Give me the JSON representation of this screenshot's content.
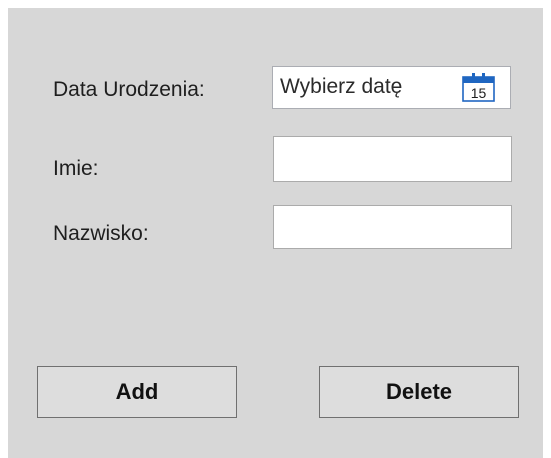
{
  "form": {
    "birthdate_label": "Data Urodzenia:",
    "birthdate_placeholder": "Wybierz datę",
    "calendar_day": "15",
    "firstname_label": "Imie:",
    "firstname_value": "",
    "lastname_label": "Nazwisko:",
    "lastname_value": ""
  },
  "buttons": {
    "add_label": "Add",
    "delete_label": "Delete"
  },
  "colors": {
    "window_background": "#d7d7d7",
    "calendar_accent": "#1f66c1"
  },
  "icons": {
    "calendar": "calendar-icon"
  }
}
